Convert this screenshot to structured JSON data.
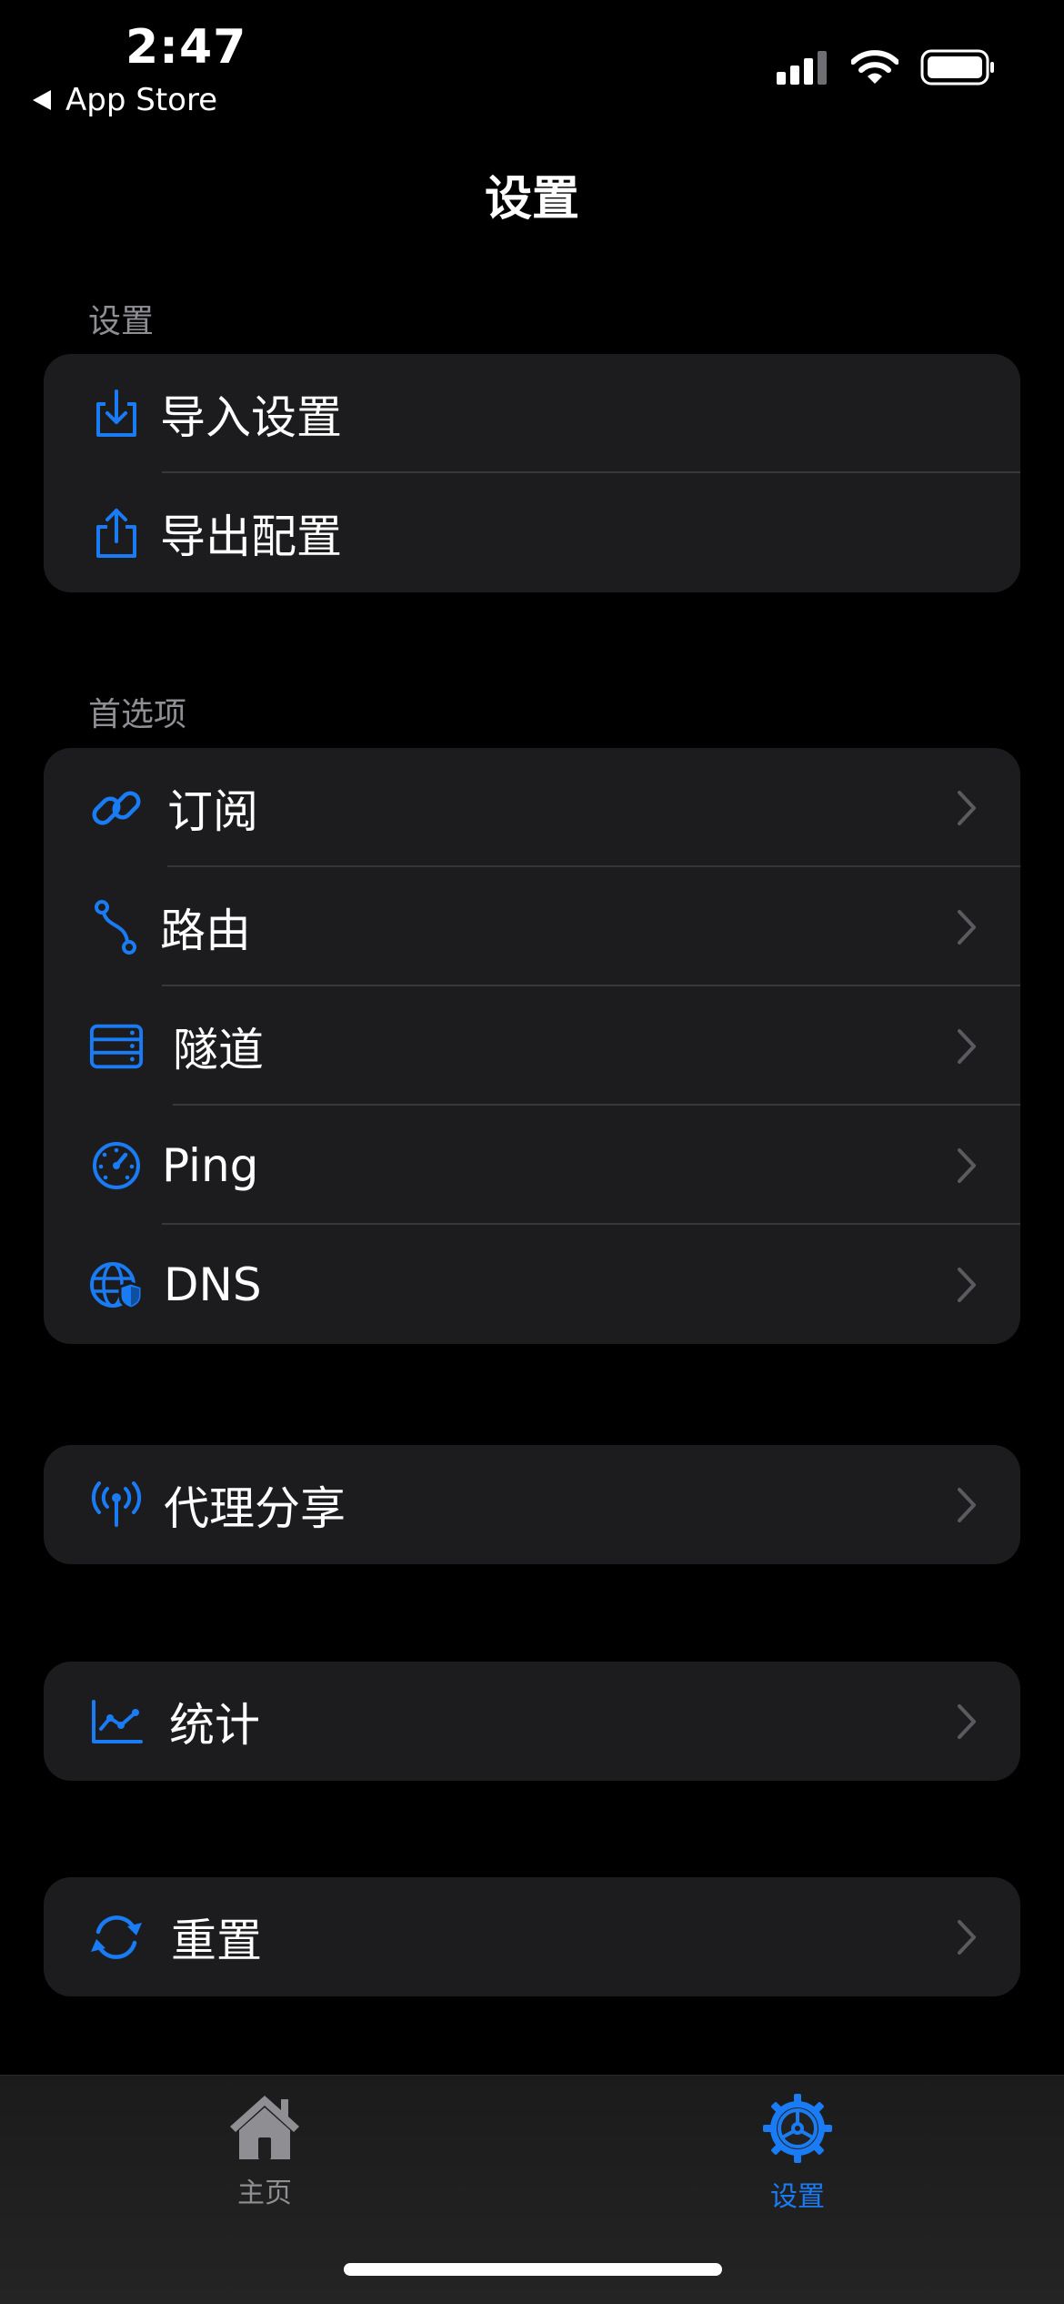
{
  "status_bar": {
    "time": "2:47",
    "back_label": "App Store"
  },
  "nav": {
    "title": "设置"
  },
  "sections": {
    "settings_header": "设置",
    "preferences_header": "首选项"
  },
  "settings_group": {
    "import_label": "导入设置",
    "export_label": "导出配置"
  },
  "preferences_group": {
    "subscribe_label": "订阅",
    "routing_label": "路由",
    "tunnel_label": "隧道",
    "ping_label": "Ping",
    "dns_label": "DNS"
  },
  "proxy_share_label": "代理分享",
  "stats_label": "统计",
  "reset_label": "重置",
  "tabbar": {
    "home_label": "主页",
    "settings_label": "设置"
  },
  "colors": {
    "accent": "#1a7cf5",
    "background": "#000000",
    "cell": "#1c1c1e",
    "separator": "#38383a",
    "secondary_text": "#8e8e93"
  },
  "icons": {
    "import": "tray-arrow-down-icon",
    "export": "share-arrow-up-icon",
    "subscribe": "link-icon",
    "routing": "route-path-icon",
    "tunnel": "server-rack-icon",
    "ping": "speedometer-icon",
    "dns": "globe-shield-icon",
    "proxy_share": "antenna-broadcast-icon",
    "stats": "line-chart-icon",
    "reset": "refresh-arrows-icon",
    "home": "house-icon",
    "settings": "gear-icon"
  }
}
